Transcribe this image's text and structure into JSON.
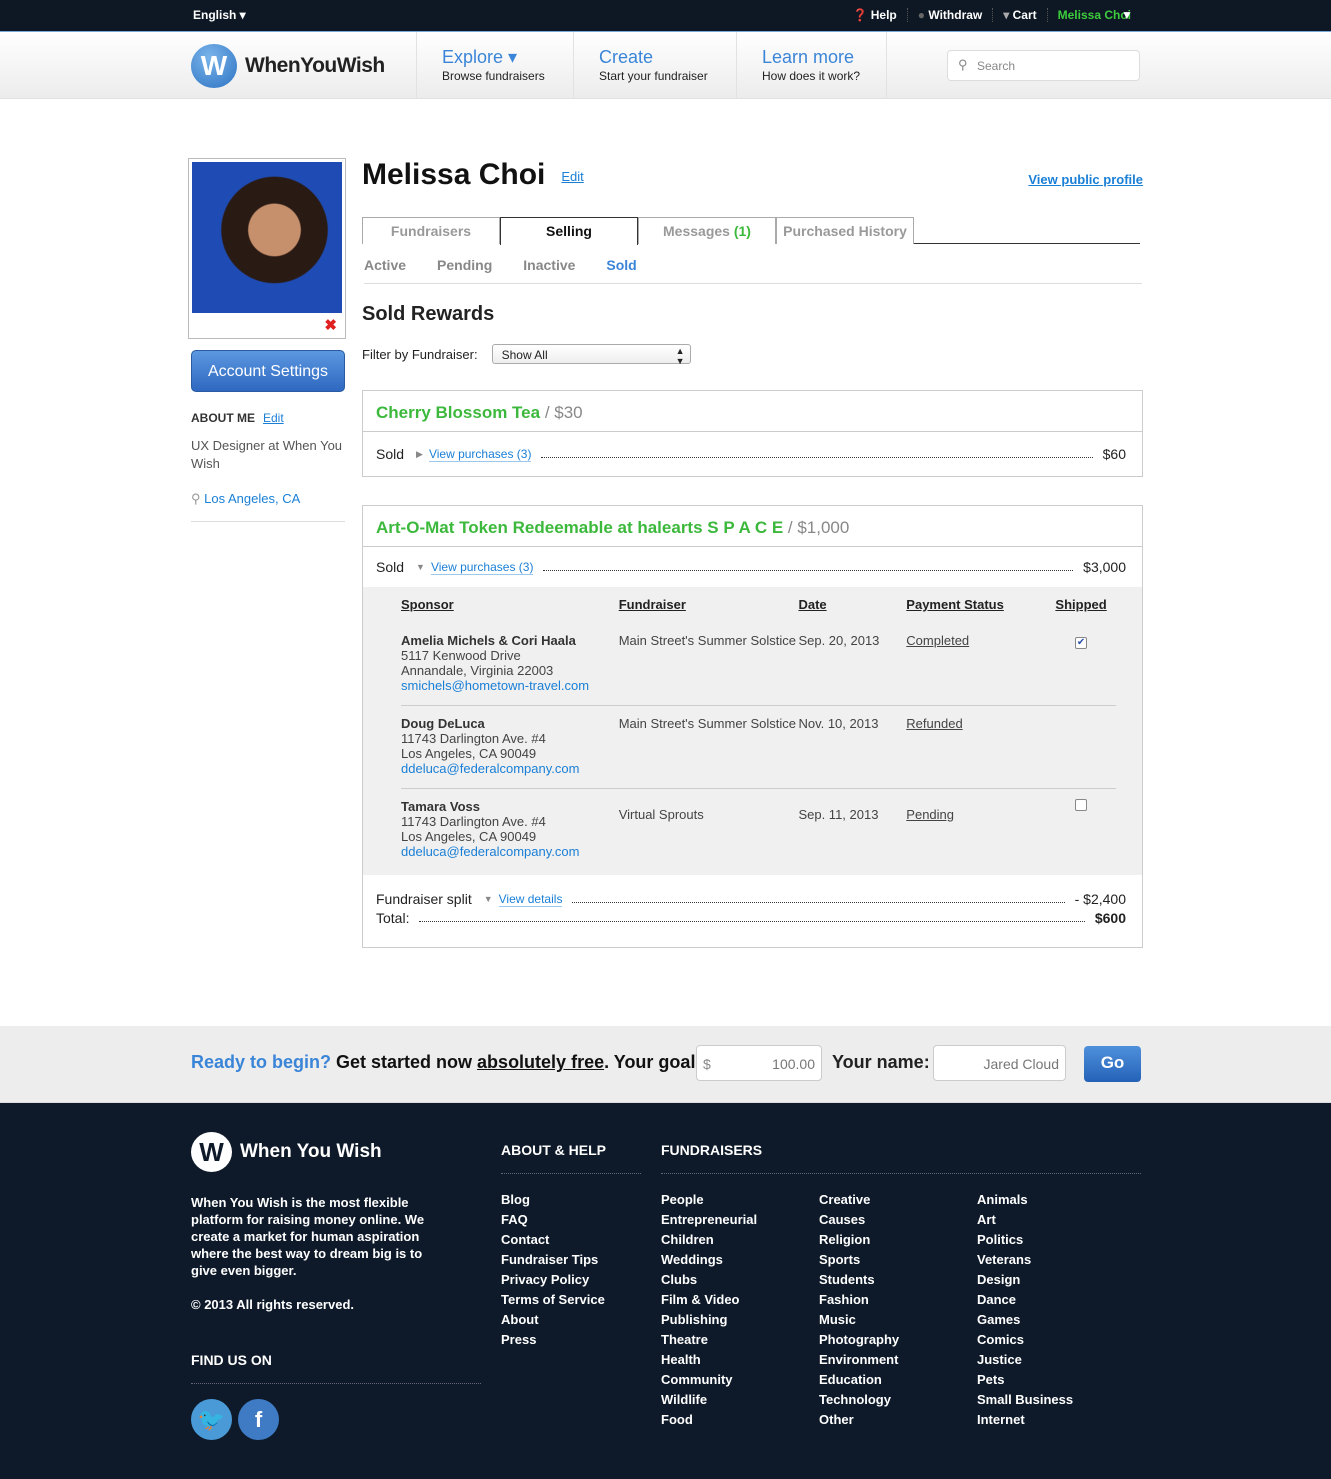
{
  "topbar": {
    "language": "English",
    "help": "Help",
    "withdraw": "Withdraw",
    "cart": "Cart",
    "user": "Melissa Choi"
  },
  "header": {
    "logo": "WhenYouWish",
    "nav": [
      {
        "title": "Explore ▾",
        "sub": "Browse fundraisers"
      },
      {
        "title": "Create",
        "sub": "Start your fundraiser"
      },
      {
        "title": "Learn more",
        "sub": "How does it work?"
      }
    ],
    "search_placeholder": "Search"
  },
  "sidebar": {
    "account_settings": "Account Settings",
    "about_label": "ABOUT ME",
    "edit": "Edit",
    "bio": "UX Designer at When You Wish",
    "location": "Los Angeles, CA"
  },
  "profile": {
    "name": "Melissa Choi",
    "edit": "Edit",
    "view_public": "View public profile"
  },
  "tabs": [
    {
      "label": "Fundraisers"
    },
    {
      "label": "Selling"
    },
    {
      "label": "Messages",
      "count": "(1)"
    },
    {
      "label": "Purchased History"
    }
  ],
  "subtabs": [
    "Active",
    "Pending",
    "Inactive",
    "Sold"
  ],
  "section_title": "Sold Rewards",
  "filter": {
    "label": "Filter by Fundraiser:",
    "value": "Show All"
  },
  "rewards": [
    {
      "name": "Cherry Blossom Tea",
      "price": "/ $30",
      "sold_label": "Sold",
      "link": "View purchases (3)",
      "total": "$60"
    },
    {
      "name": "Art-O-Mat Token Redeemable at halearts S P A C E ",
      "price": "/ $1,000",
      "sold_label": "Sold",
      "link": "View purchases (3)",
      "total": "$3,000",
      "columns": [
        "Sponsor",
        "Fundraiser",
        "Date",
        "Payment Status",
        "Shipped"
      ],
      "purchases": [
        {
          "sponsor": "Amelia Michels & Cori Haala",
          "addr1": "5117 Kenwood Drive",
          "addr2": "Annandale, Virginia 22003",
          "email": "smichels@hometown-travel.com",
          "fundraiser": "Main Street's Summer Solstice",
          "date": "Sep. 20, 2013",
          "status": "Completed",
          "shipped": true
        },
        {
          "sponsor": "Doug DeLuca",
          "addr1": "11743 Darlington Ave. #4",
          "addr2": "Los Angeles, CA 90049",
          "email": "ddeluca@federalcompany.com",
          "fundraiser": "Main Street's Summer Solstice",
          "date": "Nov. 10, 2013",
          "status": "Refunded",
          "shipped": null
        },
        {
          "sponsor": "Tamara Voss",
          "addr1": "11743 Darlington Ave. #4",
          "addr2": "Los Angeles, CA 90049",
          "email": "ddeluca@federalcompany.com",
          "fundraiser": "Virtual Sprouts",
          "date": "Sep. 11, 2013",
          "status": "Pending",
          "shipped": false
        }
      ],
      "split_label": "Fundraiser split",
      "split_link": "View details",
      "split_value": "- $2,400",
      "total_label": "Total:",
      "net": "$600"
    }
  ],
  "cta": {
    "ready": "Ready to begin?",
    "text1": " Get started now ",
    "free": "absolutely free",
    "text2": ".  Your goal:",
    "currency": "$",
    "goal": "100.00",
    "name_label": "Your name:",
    "name_value": "Jared Cloud",
    "go": "Go"
  },
  "footer": {
    "logo": "When You Wish",
    "desc": "When You Wish is the most flexible platform for raising money online. We create a market for human aspiration where the best way to dream big is to give even bigger.",
    "copyright": "© 2013 All rights reserved.",
    "find": "FIND US ON",
    "about_title": "ABOUT & HELP",
    "about_links": [
      "Blog",
      "FAQ",
      "Contact",
      "Fundraiser Tips",
      "Privacy Policy",
      "Terms of Service",
      "About",
      "Press"
    ],
    "fund_title": "FUNDRAISERS",
    "col1": [
      "People",
      "Entrepreneurial",
      "Children",
      "Weddings",
      "Clubs",
      "Film & Video",
      "Publishing",
      "Theatre",
      "Health",
      "Community",
      "Wildlife",
      "Food"
    ],
    "col2": [
      "Creative",
      "Causes",
      "Religion",
      "Sports",
      "Students",
      "Fashion",
      "Music",
      "Photography",
      "Environment",
      "Education",
      "Technology",
      "Other"
    ],
    "col3": [
      "Animals",
      "Art",
      "Politics",
      "Veterans",
      "Design",
      "Dance",
      "Games",
      "Comics",
      "Justice",
      "Pets",
      "Small Business",
      "Internet"
    ]
  }
}
